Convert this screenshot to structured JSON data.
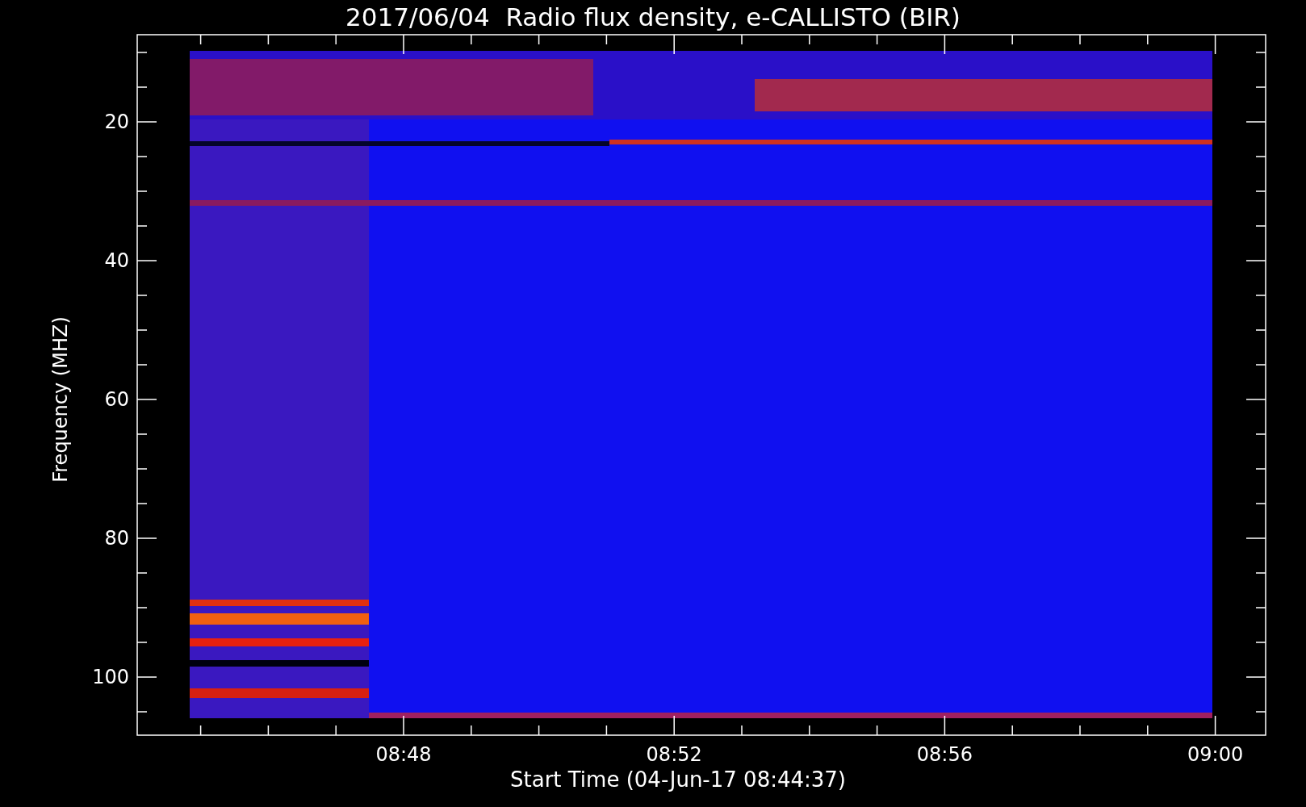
{
  "title": "2017/06/04  Radio flux density, e-CALLISTO (BIR)",
  "y_axis": {
    "label": "Frequency (MHZ)",
    "tick_labels": [
      "20",
      "40",
      "60",
      "80",
      "100"
    ]
  },
  "x_axis": {
    "label": "Start Time (04-Jun-17 08:44:37)",
    "tick_labels": [
      "08:48",
      "08:52",
      "08:56",
      "09:00"
    ]
  }
}
